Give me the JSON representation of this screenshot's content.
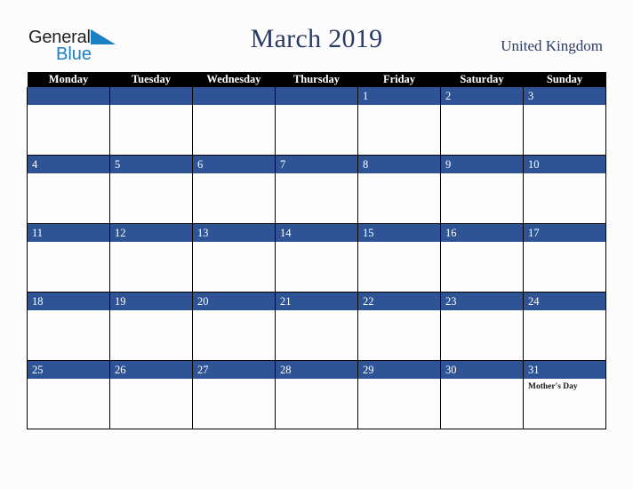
{
  "logo": {
    "word1": "General",
    "word2": "Blue",
    "triangle_color": "#1b80c4",
    "text_color": "#231f20"
  },
  "header": {
    "title": "March 2019",
    "country": "United Kingdom",
    "title_color": "#2b3c63"
  },
  "calendar": {
    "weekday_headers": [
      "Monday",
      "Tuesday",
      "Wednesday",
      "Thursday",
      "Friday",
      "Saturday",
      "Sunday"
    ],
    "header_background": "#000000",
    "daynum_background": "#2e5496",
    "weeks": [
      [
        {
          "day": "",
          "events": []
        },
        {
          "day": "",
          "events": []
        },
        {
          "day": "",
          "events": []
        },
        {
          "day": "",
          "events": []
        },
        {
          "day": "1",
          "events": []
        },
        {
          "day": "2",
          "events": []
        },
        {
          "day": "3",
          "events": []
        }
      ],
      [
        {
          "day": "4",
          "events": []
        },
        {
          "day": "5",
          "events": []
        },
        {
          "day": "6",
          "events": []
        },
        {
          "day": "7",
          "events": []
        },
        {
          "day": "8",
          "events": []
        },
        {
          "day": "9",
          "events": []
        },
        {
          "day": "10",
          "events": []
        }
      ],
      [
        {
          "day": "11",
          "events": []
        },
        {
          "day": "12",
          "events": []
        },
        {
          "day": "13",
          "events": []
        },
        {
          "day": "14",
          "events": []
        },
        {
          "day": "15",
          "events": []
        },
        {
          "day": "16",
          "events": []
        },
        {
          "day": "17",
          "events": []
        }
      ],
      [
        {
          "day": "18",
          "events": []
        },
        {
          "day": "19",
          "events": []
        },
        {
          "day": "20",
          "events": []
        },
        {
          "day": "21",
          "events": []
        },
        {
          "day": "22",
          "events": []
        },
        {
          "day": "23",
          "events": []
        },
        {
          "day": "24",
          "events": []
        }
      ],
      [
        {
          "day": "25",
          "events": []
        },
        {
          "day": "26",
          "events": []
        },
        {
          "day": "27",
          "events": []
        },
        {
          "day": "28",
          "events": []
        },
        {
          "day": "29",
          "events": []
        },
        {
          "day": "30",
          "events": []
        },
        {
          "day": "31",
          "events": [
            "Mother's Day"
          ]
        }
      ]
    ]
  }
}
